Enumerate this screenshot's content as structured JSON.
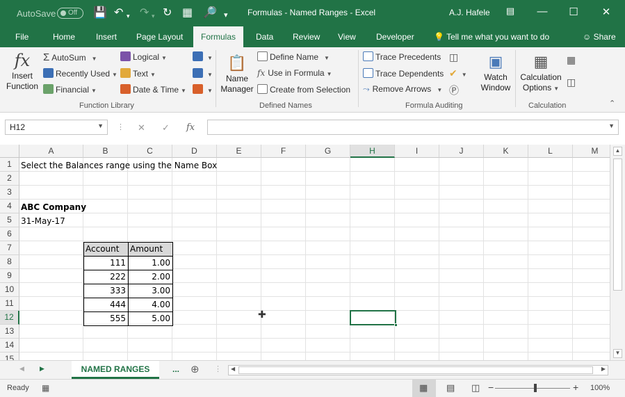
{
  "titlebar": {
    "autosave_label": "AutoSave",
    "autosave_state": "Off",
    "window_title": "Formulas - Named Ranges  -  Excel",
    "user_name": "A.J. Hafele"
  },
  "tabs": [
    "File",
    "Home",
    "Insert",
    "Page Layout",
    "Formulas",
    "Data",
    "Review",
    "View",
    "Developer"
  ],
  "active_tab": "Formulas",
  "tell_me": "Tell me what you want to do",
  "share_label": "Share",
  "ribbon": {
    "function_library": {
      "label": "Function Library",
      "insert_function": [
        "Insert",
        "Function"
      ],
      "autosum": "AutoSum",
      "recently_used": "Recently Used",
      "financial": "Financial",
      "logical": "Logical",
      "text": "Text",
      "date_time": "Date & Time"
    },
    "defined_names": {
      "label": "Defined Names",
      "name_manager": [
        "Name",
        "Manager"
      ],
      "define_name": "Define Name",
      "use_in_formula": "Use in Formula",
      "create_from_selection": "Create from Selection"
    },
    "formula_auditing": {
      "label": "Formula Auditing",
      "trace_precedents": "Trace Precedents",
      "trace_dependents": "Trace Dependents",
      "remove_arrows": "Remove Arrows",
      "watch_window": [
        "Watch",
        "Window"
      ]
    },
    "calculation": {
      "label": "Calculation",
      "calculation_options": [
        "Calculation",
        "Options"
      ]
    }
  },
  "formula_bar": {
    "name_box": "H12",
    "formula": ""
  },
  "columns": [
    "A",
    "B",
    "C",
    "D",
    "E",
    "F",
    "G",
    "H",
    "I",
    "J",
    "K",
    "L",
    "M"
  ],
  "rows": [
    "1",
    "2",
    "3",
    "4",
    "5",
    "6",
    "7",
    "8",
    "9",
    "10",
    "11",
    "12",
    "13",
    "14",
    "15"
  ],
  "selected_cell": "H12",
  "cells": {
    "a1": "Select the Balances range using the Name Box",
    "a4": "ABC Company",
    "a5": "31-May-17",
    "table_headers": [
      "Account",
      "Amount"
    ],
    "table_rows": [
      [
        "111",
        "1.00"
      ],
      [
        "222",
        "2.00"
      ],
      [
        "333",
        "3.00"
      ],
      [
        "444",
        "4.00"
      ],
      [
        "555",
        "5.00"
      ]
    ]
  },
  "sheets": {
    "active": "NAMED RANGES",
    "more": "..."
  },
  "statusbar": {
    "status": "Ready",
    "zoom": "100%"
  }
}
